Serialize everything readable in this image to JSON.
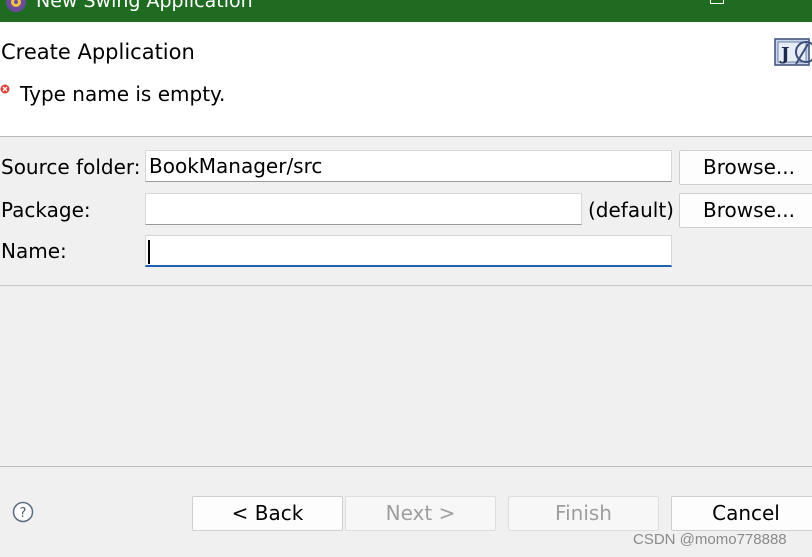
{
  "window": {
    "title": "New Swing Application"
  },
  "header": {
    "title": "Create Application",
    "error_message": "Type name is empty.",
    "wizard_icon_text": "J"
  },
  "form": {
    "source_folder": {
      "label": "Source folder:",
      "value": "BookManager/src",
      "browse_label": "Browse..."
    },
    "package": {
      "label": "Package:",
      "value": "",
      "suffix": "(default)",
      "browse_label": "Browse..."
    },
    "name": {
      "label": "Name:",
      "value": ""
    }
  },
  "footer": {
    "help_icon": "help-icon",
    "buttons": {
      "back": "< Back",
      "next": "Next >",
      "finish": "Finish",
      "cancel": "Cancel"
    }
  },
  "watermark": "CSDN @momo778888",
  "colors": {
    "titlebar": "#1f6b22",
    "header_bg": "#ffffff",
    "dialog_bg": "#f0f0f0",
    "focus_accent": "#1f5fb0",
    "error_red": "#d9403a"
  }
}
